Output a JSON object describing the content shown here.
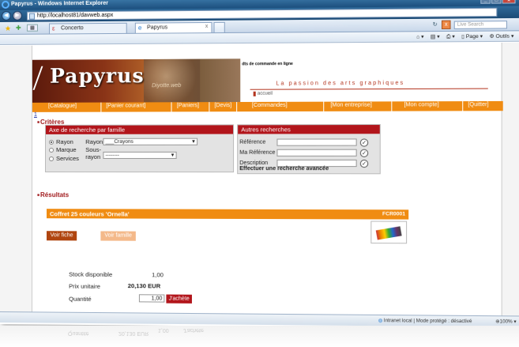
{
  "browser": {
    "window_title": "Papyrus - Windows Internet Explorer",
    "url": "http://localhost81/davweb.aspx",
    "tabs": [
      {
        "label": "Concerto"
      },
      {
        "label": "Papyrus"
      }
    ],
    "search_placeholder": "Live Search",
    "commands": [
      "Page",
      "Outils"
    ],
    "status_zone": "Intranet local | Mode protégé : désactivé",
    "zoom": "100%"
  },
  "site": {
    "logo": "Papyrus",
    "watermark": "Diyotte.web",
    "tagline": "dts de commande en ligne",
    "passion": "La passion des arts graphiques",
    "accueil": "accueil",
    "menu": [
      "[Catalogue]",
      "[Panier courant]",
      "[Paniers]",
      "[Devis]",
      "[Commandes]",
      "[Mon entreprise]",
      "[Mon compte]",
      "[Quitter]"
    ],
    "menu_number": "1"
  },
  "criteria": {
    "title": "Critères",
    "box_title": "Axe de recherche par famille",
    "radios": [
      {
        "label": "Rayon",
        "selected": true
      },
      {
        "label": "Marque",
        "selected": false
      },
      {
        "label": "Services",
        "selected": false
      }
    ],
    "rayon_label": "Rayon",
    "rayon_value": "___Crayons",
    "sousrayon_label_1": "Sous-",
    "sousrayon_label_2": "rayon",
    "sousrayon_value": "--------"
  },
  "other_search": {
    "title": "Autres recherches",
    "fields": [
      {
        "label": "Référence",
        "value": ""
      },
      {
        "label": "Ma Référence",
        "value": ""
      },
      {
        "label": "Description",
        "value": ""
      }
    ],
    "advanced": "Effectuer une recherche avancée"
  },
  "results": {
    "title": "Résultats",
    "product_name": "Coffret 25 couleurs 'Ornella'",
    "product_code": "FCR0001",
    "btn_fiche": "Voir fiche",
    "btn_famille": "Voir famille",
    "stock_label": "Stock disponible",
    "stock_value": "1,00",
    "price_label": "Prix unitaire",
    "price_value": "20,130 EUR",
    "qty_label": "Quantité",
    "qty_value": "1,00",
    "buy_label": "J'achète"
  }
}
